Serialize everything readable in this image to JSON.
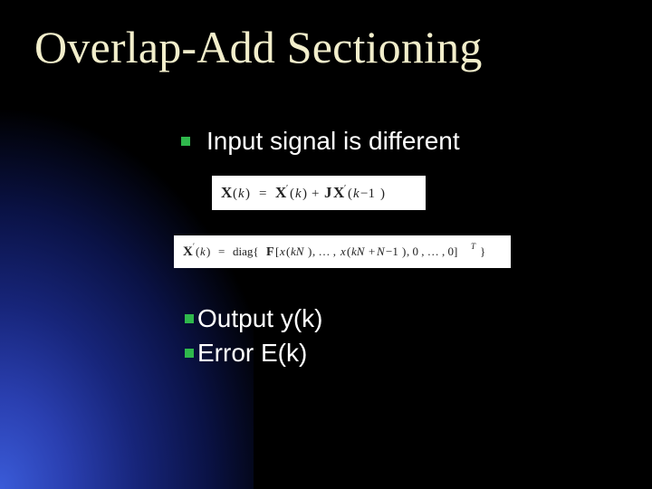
{
  "title": "Overlap-Add Sectioning",
  "bullets": {
    "top": "Input signal is different",
    "output": "Output y(k)",
    "error": "Error E(k)"
  },
  "equations": {
    "eq1_plain": "X(k) = X'(k) + J X'(k-1)",
    "eq2_plain": "X'(k) = diag{ F[x(kN), ..., x(kN+N-1), 0, ..., 0]^T }"
  },
  "colors": {
    "title": "#f2eecb",
    "bullet": "#2fb84c",
    "background": "#000000",
    "accent_gradient_inner": "#3a5bd8"
  }
}
